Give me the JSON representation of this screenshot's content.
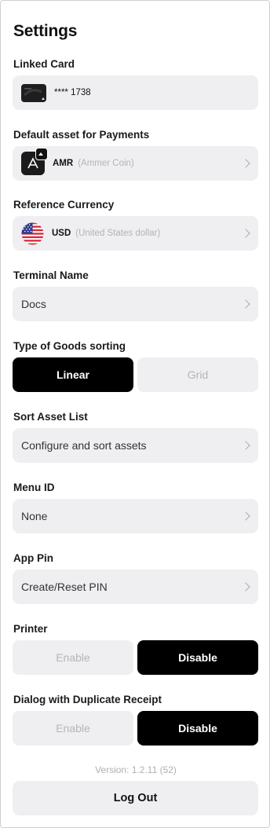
{
  "page": {
    "title": "Settings"
  },
  "linked_card": {
    "label": "Linked Card",
    "number": "**** 1738"
  },
  "default_asset": {
    "label": "Default asset for Payments",
    "code": "AMR",
    "name": "(Ammer Coin)"
  },
  "reference_currency": {
    "label": "Reference Currency",
    "code": "USD",
    "name": "(United States dollar)"
  },
  "terminal_name": {
    "label": "Terminal Name",
    "value": "Docs"
  },
  "goods_sorting": {
    "label": "Type of Goods sorting",
    "options": [
      "Linear",
      "Grid"
    ],
    "selected": "Linear"
  },
  "sort_asset_list": {
    "label": "Sort Asset List",
    "value": "Configure and sort assets"
  },
  "menu_id": {
    "label": "Menu ID",
    "value": "None"
  },
  "app_pin": {
    "label": "App Pin",
    "value": "Create/Reset PIN"
  },
  "printer": {
    "label": "Printer",
    "options": [
      "Enable",
      "Disable"
    ],
    "selected": "Disable"
  },
  "duplicate_receipt": {
    "label": "Dialog with Duplicate Receipt",
    "options": [
      "Enable",
      "Disable"
    ],
    "selected": "Disable"
  },
  "version": "Version: 1.2.11 (52)",
  "logout_label": "Log Out",
  "icons": [
    "chevron-right-icon",
    "card-icon",
    "ammer-coin-icon",
    "us-flag-icon"
  ],
  "colors": {
    "accent": "#000000",
    "field_bg": "#efeff2",
    "muted_text": "#b3b3b8"
  }
}
